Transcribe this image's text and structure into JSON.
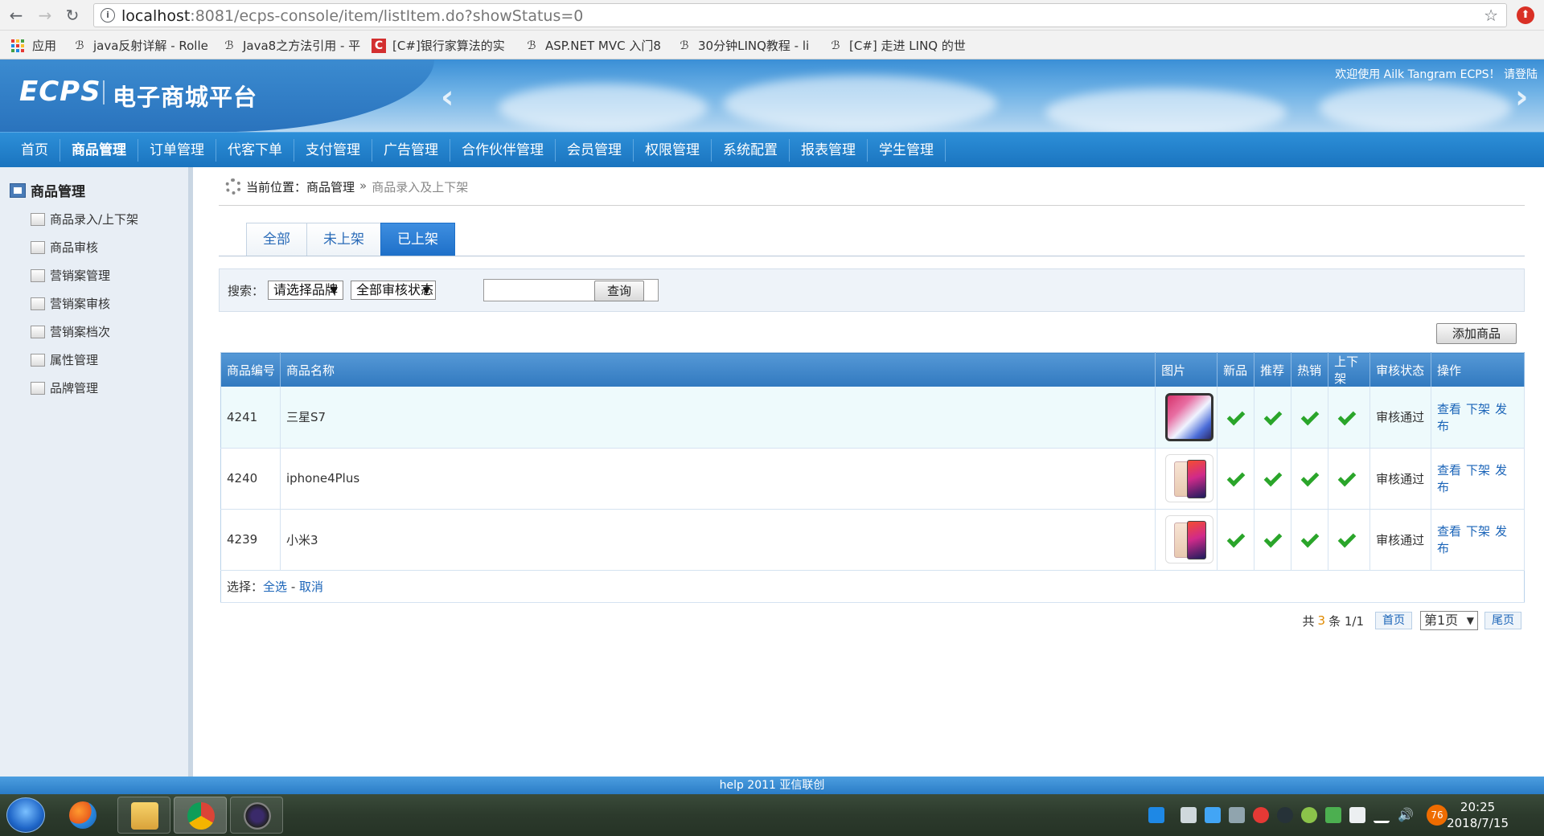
{
  "browser": {
    "url_host": "localhost",
    "url_path": ":8081/ecps-console/item/listItem.do?showStatus=0",
    "bookmarks": [
      {
        "label": "应用"
      },
      {
        "label": "java反射详解 - Rolle"
      },
      {
        "label": "Java8之方法引用 - 平"
      },
      {
        "label": "[C#]银行家算法的实"
      },
      {
        "label": "ASP.NET MVC 入门8"
      },
      {
        "label": "30分钟LINQ教程 - li"
      },
      {
        "label": "[C#] 走进 LINQ 的世"
      }
    ]
  },
  "header": {
    "logo_en": "ECPS",
    "logo_cn": "电子商城平台",
    "welcome": "欢迎使用 Ailk Tangram ECPS！ 请登陆"
  },
  "mainnav": {
    "items": [
      "首页",
      "商品管理",
      "订单管理",
      "代客下单",
      "支付管理",
      "广告管理",
      "合作伙伴管理",
      "会员管理",
      "权限管理",
      "系统配置",
      "报表管理",
      "学生管理"
    ],
    "active_index": 1
  },
  "sidebar": {
    "title": "商品管理",
    "items": [
      "商品录入/上下架",
      "商品审核",
      "营销案管理",
      "营销案审核",
      "营销案档次",
      "属性管理",
      "品牌管理"
    ]
  },
  "breadcrumb": {
    "prefix": "当前位置：",
    "current": "商品管理",
    "sep": "»",
    "last": "商品录入及上下架"
  },
  "tabs": {
    "items": [
      "全部",
      "未上架",
      "已上架"
    ],
    "active_index": 2
  },
  "search": {
    "label": "搜索：",
    "brand_select": "请选择品牌",
    "audit_select": "全部审核状态",
    "keyword_value": "",
    "query_button": "查询"
  },
  "actions": {
    "add_button": "添加商品"
  },
  "table": {
    "columns": [
      "商品编号",
      "商品名称",
      "图片",
      "新品",
      "推荐",
      "热销",
      "上下架",
      "审核状态",
      "操作"
    ],
    "rows": [
      {
        "id": "4241",
        "name": "三星S7",
        "image": "phone-x",
        "status": "审核通过",
        "ops": [
          "查看",
          "下架",
          "发布"
        ]
      },
      {
        "id": "4240",
        "name": "iphone4Plus",
        "image": "phone-mi",
        "status": "审核通过",
        "ops": [
          "查看",
          "下架",
          "发布"
        ]
      },
      {
        "id": "4239",
        "name": "小米3",
        "image": "phone-mi",
        "status": "审核通过",
        "ops": [
          "查看",
          "下架",
          "发布"
        ]
      }
    ],
    "select_label": "选择：",
    "select_all": "全选",
    "select_dash": "-",
    "select_cancel": "取消"
  },
  "pager": {
    "total_prefix": "共",
    "total_count": "3",
    "total_suffix": "条 1/1",
    "first": "首页",
    "page_select": "第1页",
    "last": "尾页"
  },
  "footer": {
    "text": "help 2011 亚信联创"
  },
  "taskbar": {
    "time": "20:25",
    "date": "2018/7/15",
    "tray_badge": "76"
  },
  "colors": {
    "brand_blue": "#1a74bf",
    "check_green": "#2aa52a",
    "link_blue": "#1a64b8"
  }
}
